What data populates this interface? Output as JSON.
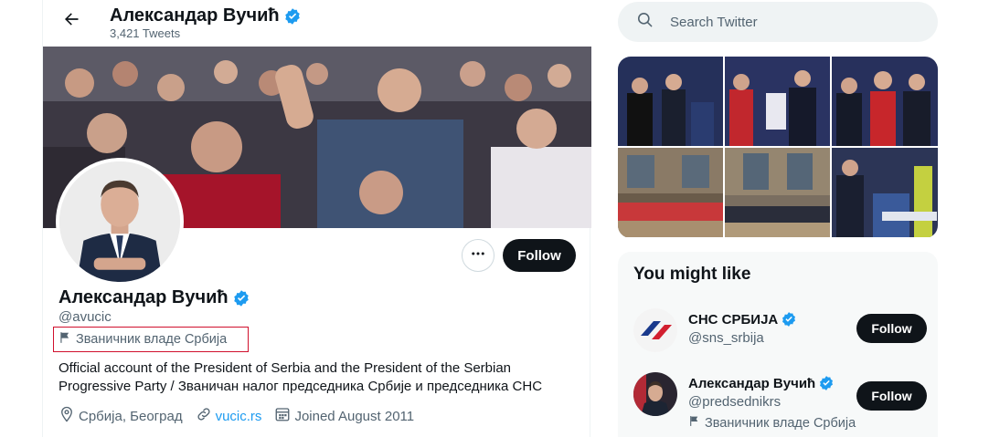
{
  "colors": {
    "accent": "#1d9bf0",
    "text_primary": "#0f1419",
    "text_secondary": "#536471",
    "button_dark": "#0f1419",
    "highlight_box": "#d0102d",
    "search_bg": "#eff3f4",
    "card_bg": "#f7f9f9"
  },
  "header": {
    "back_icon": "arrow-left-icon",
    "name": "Александар Вучић",
    "tweet_count": "3,421 Tweets"
  },
  "profile": {
    "name": "Александар Вучић",
    "handle": "@avucic",
    "label_icon": "flag-icon",
    "label": "Званичник владе Србија",
    "bio": "Official account of the President of Serbia and the President of the Serbian Progressive Party / Званичан налог председника Србије и председника СНС",
    "location": "Србија, Београд",
    "website": "vucic.rs",
    "joined": "Joined August 2011",
    "follow_label": "Follow",
    "more_icon": "more-dots-icon"
  },
  "search": {
    "placeholder": "Search Twitter",
    "icon": "search-icon"
  },
  "you_might_like": {
    "title": "You might like",
    "items": [
      {
        "name": "СНС СРБИЈА",
        "handle": "@sns_srbija",
        "follow_label": "Follow",
        "label": ""
      },
      {
        "name": "Александар Вучић",
        "handle": "@predsednikrs",
        "follow_label": "Follow",
        "label": "Званичник владе Србија"
      }
    ]
  }
}
